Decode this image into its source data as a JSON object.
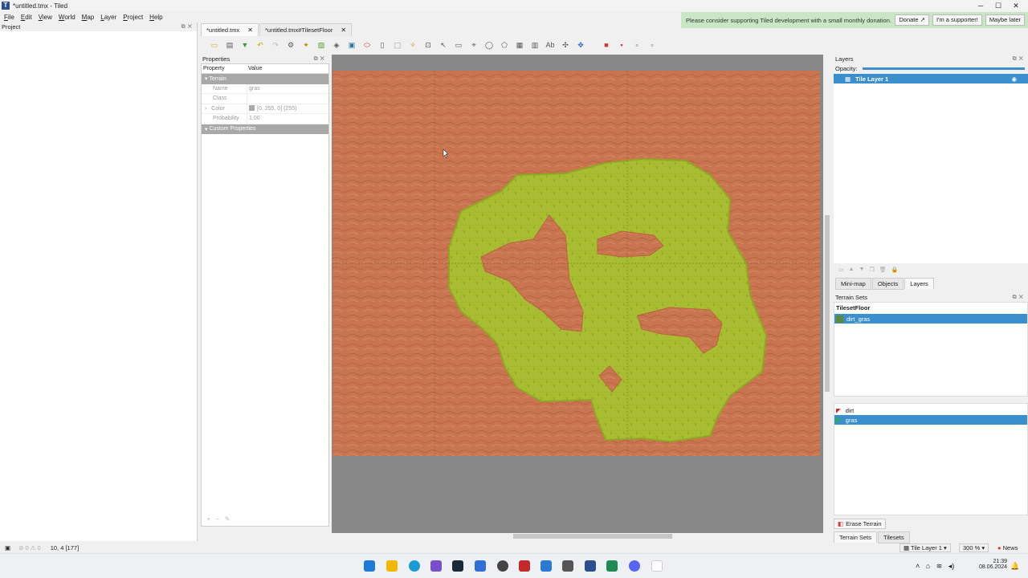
{
  "window": {
    "title": "*untitled.tmx - Tiled",
    "app_icon": "tiled-icon"
  },
  "menubar": [
    "File",
    "Edit",
    "View",
    "World",
    "Map",
    "Layer",
    "Project",
    "Help"
  ],
  "banner": {
    "message": "Please consider supporting Tiled development with a small monthly donation.",
    "donate": "Donate ↗",
    "supporter": "I'm a supporter!",
    "later": "Maybe later"
  },
  "project_panel": {
    "title": "Project"
  },
  "tabs": [
    {
      "label": "*untitled.tmx"
    },
    {
      "label": "*untitled.tmx#TilesetFloor"
    }
  ],
  "properties": {
    "title": "Properties",
    "col_property": "Property",
    "col_value": "Value",
    "group_terrain": "Terrain",
    "rows": [
      {
        "key": "Name",
        "value": "gras"
      },
      {
        "key": "Class",
        "value": ""
      },
      {
        "key": "Color",
        "value": "[0, 255, 0] (255)"
      },
      {
        "key": "Probability",
        "value": "1,00"
      }
    ],
    "group_custom": "Custom Properties"
  },
  "layers_panel": {
    "title": "Layers",
    "opacity_label": "Opacity:",
    "layer_name": "Tile Layer 1"
  },
  "dock_tabs_top": [
    "Mini-map",
    "Objects",
    "Layers"
  ],
  "terrain_sets": {
    "title": "Terrain Sets",
    "tileset": "TilesetFloor",
    "set_name": "dirt_gras",
    "terrains": [
      {
        "name": "dirt",
        "color": "#e02020"
      },
      {
        "name": "gras",
        "color": "#20c020"
      }
    ],
    "erase_button": "Erase Terrain",
    "tabs": [
      "Terrain Sets",
      "Tilesets"
    ]
  },
  "statusbar": {
    "coords": "10, 4 [177]",
    "layer_select": "Tile Layer 1",
    "zoom": "300 %",
    "news": "News"
  },
  "clock": {
    "time": "21:39",
    "date": "08.06.2024"
  },
  "colors": {
    "dirt": "#c97650",
    "grass": "#a8bd32",
    "selection": "#3c8fcd",
    "canvas_bg": "#888888"
  }
}
